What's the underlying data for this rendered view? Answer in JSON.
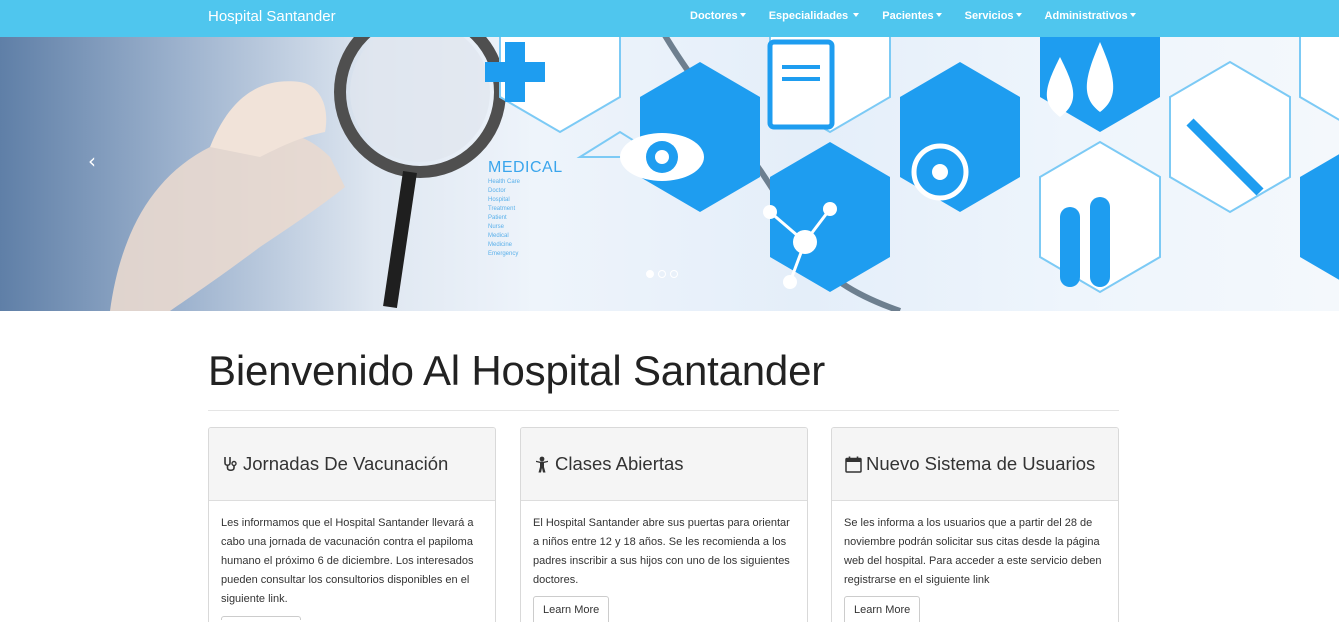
{
  "navbar": {
    "brand": "Hospital Santander",
    "items": [
      {
        "label": "Doctores"
      },
      {
        "label": "Especialidades"
      },
      {
        "label": "Pacientes"
      },
      {
        "label": "Servicios"
      },
      {
        "label": "Administrativos"
      }
    ]
  },
  "carousel": {
    "prev_icon": "‹",
    "medical_label": "MEDICAL",
    "slides_count": 3,
    "active_slide": 1
  },
  "main": {
    "title": "Bienvenido Al Hospital Santander"
  },
  "panels": [
    {
      "icon": "stethoscope-icon",
      "title": "Jornadas De Vacunación",
      "body": "Les informamos que el Hospital Santander llevará a cabo una jornada de vacunación contra el papiloma humano el próximo 6 de diciembre. Los interesados pueden consultar los consultorios disponibles en el siguiente link."
    },
    {
      "icon": "child-icon",
      "title": "Clases Abiertas",
      "body": "El Hospital Santander abre sus puertas para orientar a niños entre 12 y 18 años. Se les recomienda a los padres inscribir a sus hijos con uno de los siguientes doctores.",
      "button": "Learn More"
    },
    {
      "icon": "calendar-icon",
      "title": "Nuevo Sistema de Usuarios",
      "body": "Se les informa a los usuarios que a partir del 28 de noviembre podrán solicitar sus citas desde la página web del hospital. Para acceder a este servicio deben registrarse en el siguiente link",
      "button": "Learn More"
    }
  ],
  "colors": {
    "navbar": "#4fc6ee",
    "hex_blue": "#1e9df0"
  }
}
